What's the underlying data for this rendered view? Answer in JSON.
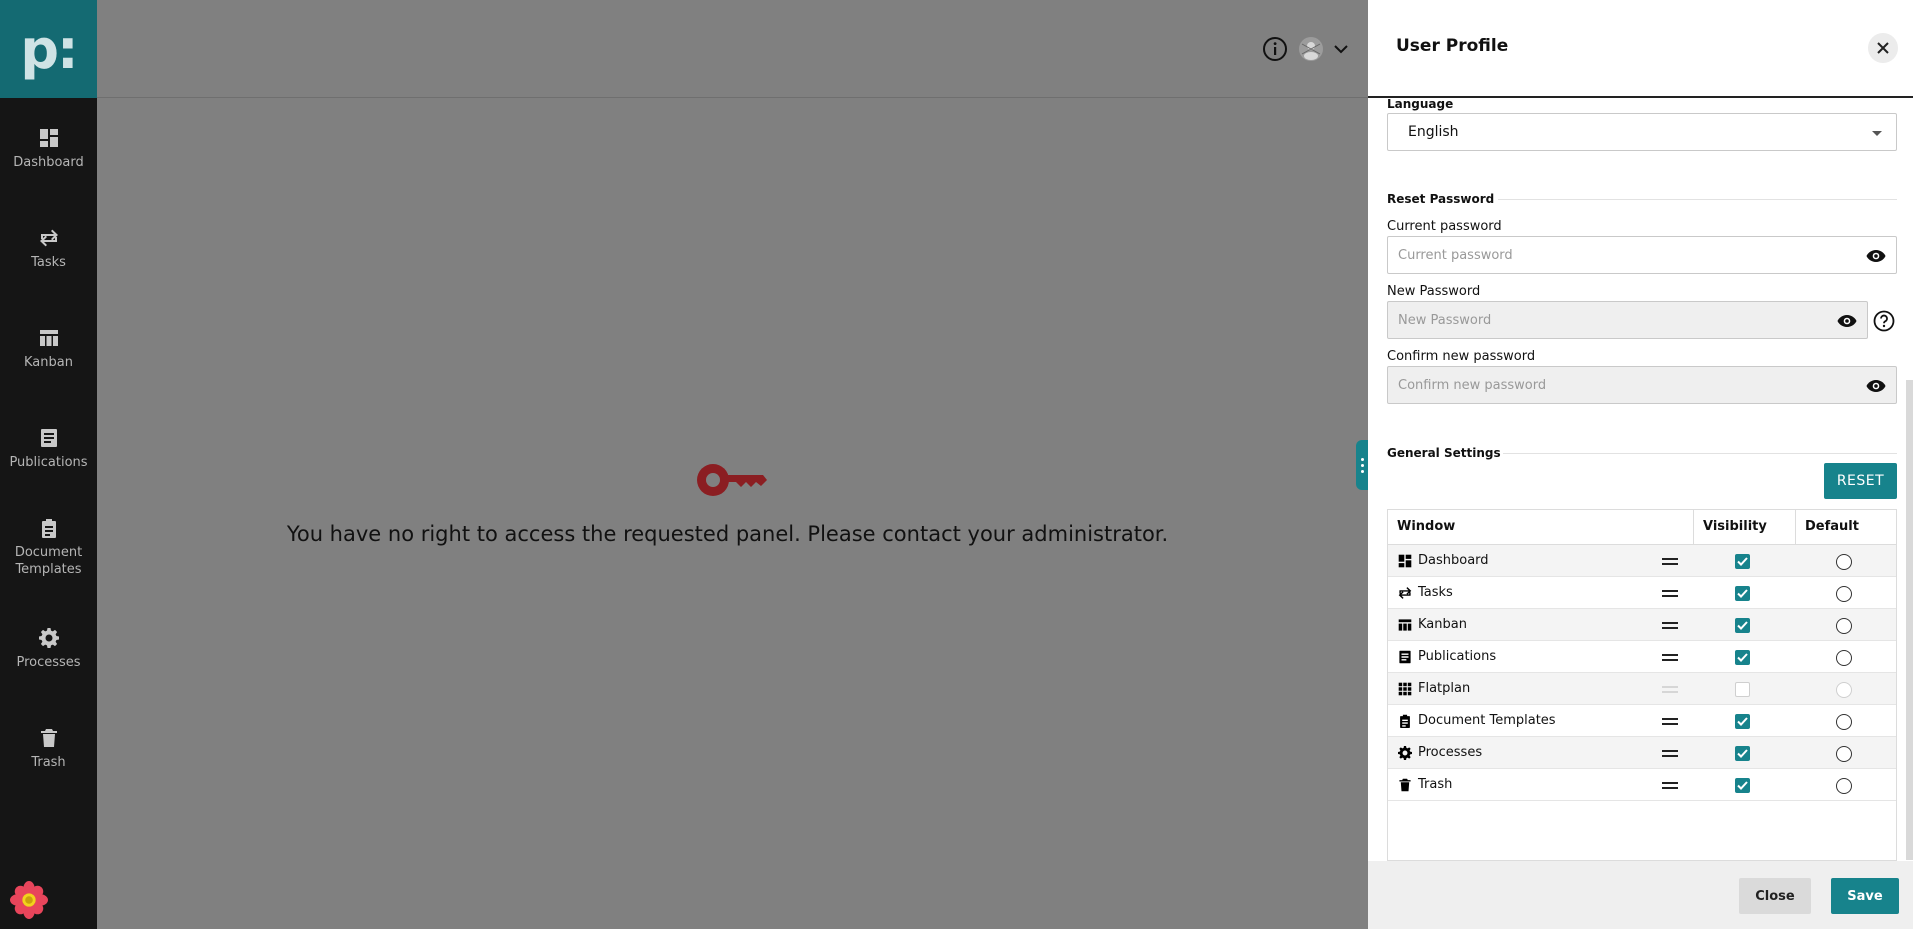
{
  "sidebar": {
    "logo": "p:",
    "items": [
      {
        "label": "Dashboard",
        "icon": "dashboard-icon"
      },
      {
        "label": "Tasks",
        "icon": "tasks-icon"
      },
      {
        "label": "Kanban",
        "icon": "kanban-icon"
      },
      {
        "label": "Publications",
        "icon": "publications-icon"
      },
      {
        "label": "Document Templates",
        "icon": "document-templates-icon"
      },
      {
        "label": "Processes",
        "icon": "processes-icon"
      },
      {
        "label": "Trash",
        "icon": "trash-icon"
      }
    ]
  },
  "main": {
    "message": "You have no right to access the requested panel. Please contact your administrator."
  },
  "drawer": {
    "title": "User Profile",
    "language": {
      "label": "Language",
      "value": "English"
    },
    "reset_password": {
      "section_title": "Reset Password",
      "current": {
        "label": "Current password",
        "placeholder": "Current password"
      },
      "new": {
        "label": "New Password",
        "placeholder": "New Password"
      },
      "confirm": {
        "label": "Confirm new password",
        "placeholder": "Confirm new password"
      }
    },
    "general_settings": {
      "section_title": "General Settings",
      "reset_label": "RESET",
      "columns": [
        "Window",
        "Visibility",
        "Default"
      ],
      "rows": [
        {
          "name": "Dashboard",
          "visible": true,
          "enabled": true
        },
        {
          "name": "Tasks",
          "visible": true,
          "enabled": true
        },
        {
          "name": "Kanban",
          "visible": true,
          "enabled": true
        },
        {
          "name": "Publications",
          "visible": true,
          "enabled": true
        },
        {
          "name": "Flatplan",
          "visible": false,
          "enabled": false
        },
        {
          "name": "Document Templates",
          "visible": true,
          "enabled": true
        },
        {
          "name": "Processes",
          "visible": true,
          "enabled": true
        },
        {
          "name": "Trash",
          "visible": true,
          "enabled": true
        }
      ]
    },
    "footer": {
      "close_label": "Close",
      "save_label": "Save"
    }
  },
  "colors": {
    "accent": "#17838c",
    "logo_bg": "#146a72",
    "key": "#8b1e22"
  }
}
